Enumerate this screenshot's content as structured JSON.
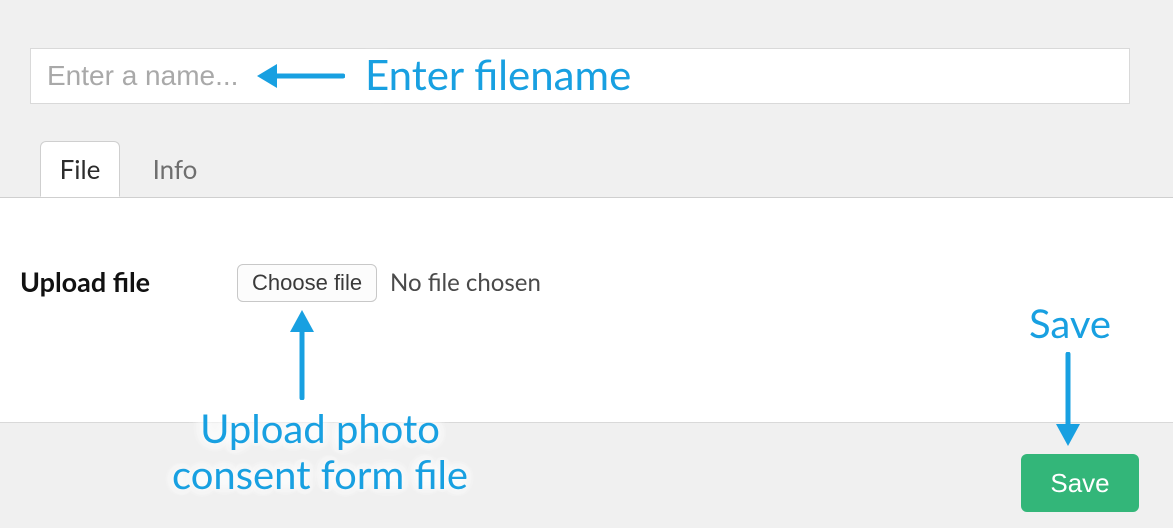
{
  "name_field": {
    "placeholder": "Enter a name...",
    "value": ""
  },
  "tabs": {
    "file": "File",
    "info": "Info"
  },
  "upload": {
    "label": "Upload file",
    "choose_button": "Choose file",
    "status": "No file chosen"
  },
  "actions": {
    "save": "Save"
  },
  "annotations": {
    "filename_hint": "Enter filename",
    "upload_hint_line1": "Upload photo",
    "upload_hint_line2": "consent form file",
    "save_hint": "Save"
  },
  "colors": {
    "annotation": "#18a0e1",
    "save_bg": "#33b679"
  }
}
